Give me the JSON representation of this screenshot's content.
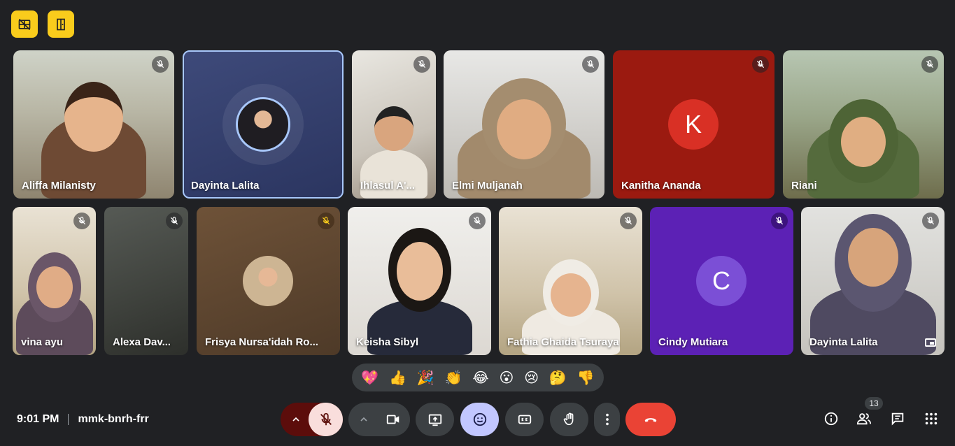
{
  "meeting": {
    "time": "9:01 PM",
    "code": "mmk-bnrh-frr",
    "participant_count": "13"
  },
  "top_buttons": [
    {
      "icon": "no-video-grid-icon"
    },
    {
      "icon": "door-icon"
    }
  ],
  "participants": [
    {
      "name": "Aliffa Milanisty",
      "state": "video",
      "muted": true
    },
    {
      "name": "Dayinta Lalita",
      "state": "avatar",
      "muted": false,
      "active": true
    },
    {
      "name": "Ihlasul A'...",
      "state": "video",
      "muted": true
    },
    {
      "name": "Elmi Muljanah",
      "state": "video",
      "muted": true
    },
    {
      "name": "Kanitha Ananda",
      "state": "letter",
      "letter": "K",
      "muted": true
    },
    {
      "name": "Riani",
      "state": "video",
      "muted": true
    },
    {
      "name": "vina ayu",
      "state": "video",
      "muted": true
    },
    {
      "name": "Alexa Dav...",
      "state": "video",
      "muted": true
    },
    {
      "name": "Frisya Nursa'idah Ro...",
      "state": "avatar",
      "muted": true
    },
    {
      "name": "Keisha Sibyl",
      "state": "video",
      "muted": true
    },
    {
      "name": "Fathia Ghaida Tsuraya",
      "state": "video",
      "muted": true
    },
    {
      "name": "Cindy Mutiara",
      "state": "letter",
      "letter": "C",
      "muted": true
    },
    {
      "name": "Dayinta Lalita",
      "state": "video",
      "muted": true,
      "self": true
    }
  ],
  "reactions": [
    "💖",
    "👍",
    "🎉",
    "👏",
    "😂",
    "😮",
    "😢",
    "🤔",
    "👎"
  ],
  "controls": {
    "mic": "microphone-off-icon",
    "camera": "video-camera-icon",
    "present": "present-screen-icon",
    "emoji": "emoji-icon",
    "captions": "closed-captions-icon",
    "hand": "raise-hand-icon",
    "more": "more-options-icon",
    "leave": "leave-call-icon"
  },
  "colors": {
    "background": "#202124",
    "control": "#3c4043",
    "leave": "#ea4335",
    "mic_off": "#f9dedc",
    "emoji_active": "#c2c7ff",
    "highlight": "#f9cc1c"
  }
}
